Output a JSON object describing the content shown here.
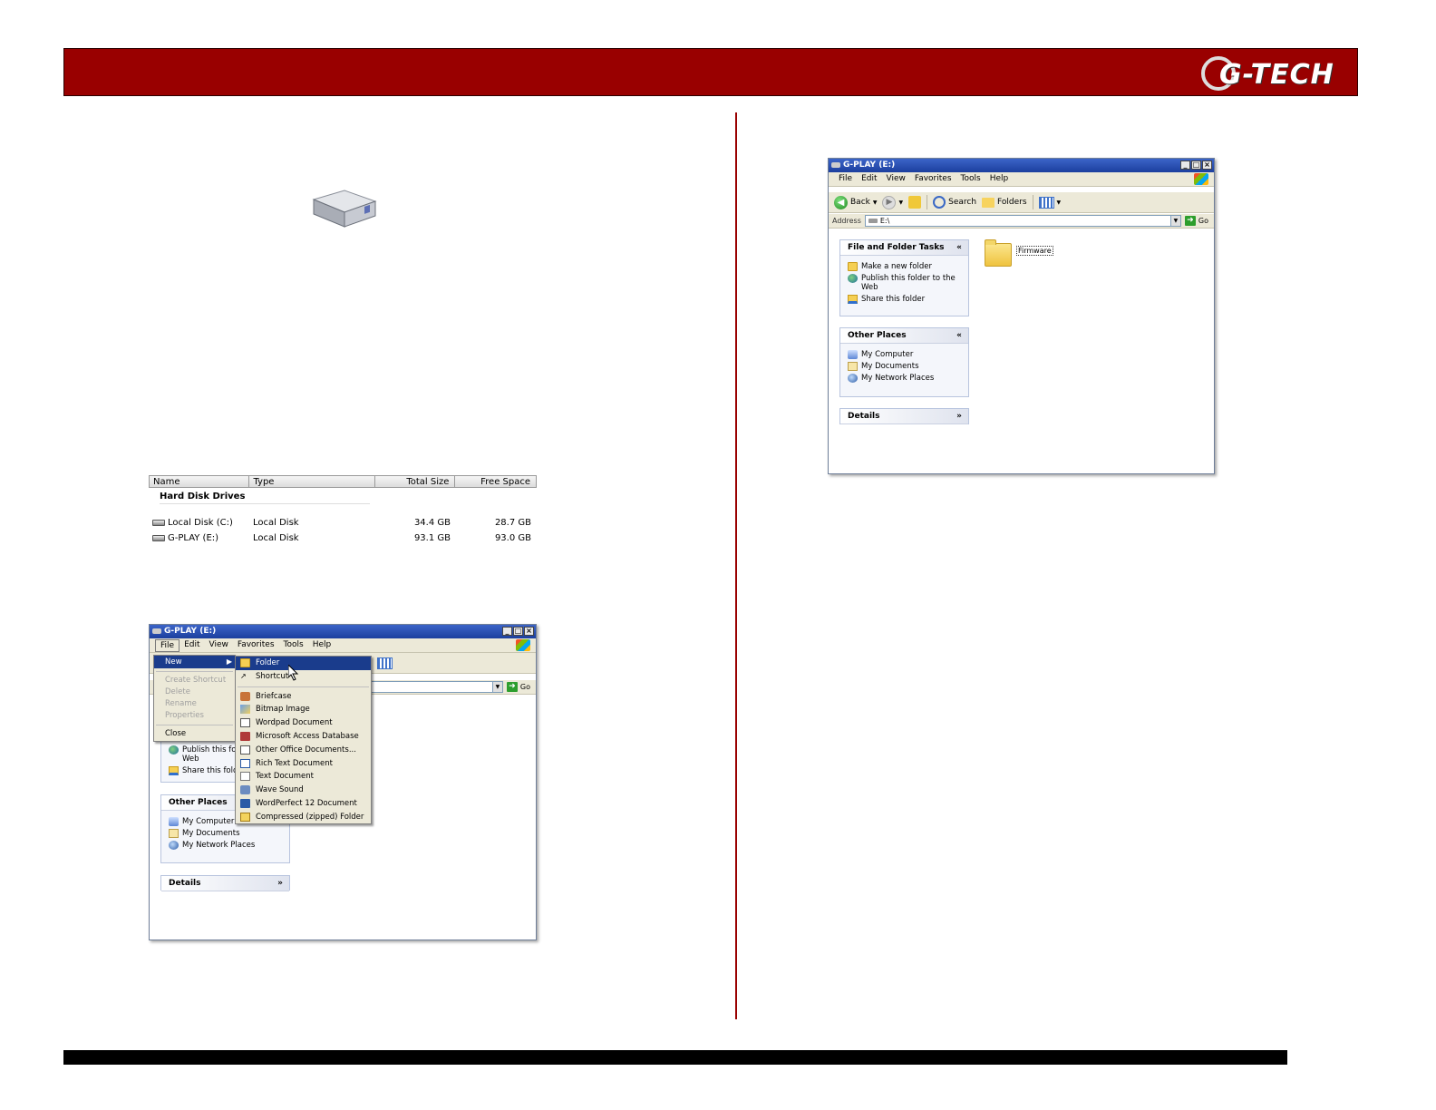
{
  "header": {
    "logo_text": "G-TECH",
    "color": "#990000"
  },
  "left_window": {
    "title": "G-PLAY (E:)",
    "menu": [
      "File",
      "Edit",
      "View",
      "Favorites",
      "Tools",
      "Help"
    ],
    "go_label": "Go",
    "file_menu": [
      {
        "label": "New",
        "state": "selected",
        "submenu": true
      },
      {
        "label": "Create Shortcut",
        "state": "disabled"
      },
      {
        "label": "Delete",
        "state": "disabled"
      },
      {
        "label": "Rename",
        "state": "disabled"
      },
      {
        "label": "Properties",
        "state": "disabled"
      },
      {
        "label": "Close",
        "state": "normal"
      }
    ],
    "new_submenu": [
      {
        "label": "Folder",
        "icon": "folder-icon"
      },
      {
        "label": "Shortcut",
        "icon": "shortcut-icon"
      },
      {
        "label": "Briefcase",
        "icon": "briefcase-icon"
      },
      {
        "label": "Bitmap Image",
        "icon": "bitmap-icon"
      },
      {
        "label": "Wordpad Document",
        "icon": "wordpad-icon"
      },
      {
        "label": "Microsoft Access Database",
        "icon": "access-icon"
      },
      {
        "label": "Other Office Documents...",
        "icon": "office-icon"
      },
      {
        "label": "Rich Text Document",
        "icon": "rtf-icon"
      },
      {
        "label": "Text Document",
        "icon": "text-icon"
      },
      {
        "label": "Wave Sound",
        "icon": "wave-icon"
      },
      {
        "label": "WordPerfect 12 Document",
        "icon": "wordperfect-icon"
      },
      {
        "label": "Compressed (zipped) Folder",
        "icon": "zip-icon"
      }
    ],
    "tasks_partial": [
      "Publish this fol",
      "Web",
      "Share this fold"
    ],
    "other_places": {
      "title": "Other Places",
      "items": [
        "My Computer",
        "My Documents",
        "My Network Places"
      ]
    },
    "details_title": "Details"
  },
  "disk_list": {
    "columns": [
      "Name",
      "Type",
      "Total Size",
      "Free Space"
    ],
    "group": "Hard Disk Drives",
    "rows": [
      {
        "name": "Local Disk (C:)",
        "type": "Local Disk",
        "total": "34.4 GB",
        "free": "28.7 GB"
      },
      {
        "name": "G-PLAY (E:)",
        "type": "Local Disk",
        "total": "93.1 GB",
        "free": "93.0 GB"
      }
    ]
  },
  "right_window": {
    "title": "G-PLAY (E:)",
    "menu": [
      "File",
      "Edit",
      "View",
      "Favorites",
      "Tools",
      "Help"
    ],
    "toolbar": {
      "back": "Back",
      "search": "Search",
      "folders": "Folders"
    },
    "address_label": "Address",
    "address_value": "E:\\",
    "go_label": "Go",
    "file_tasks": {
      "title": "File and Folder Tasks",
      "items": [
        "Make a new folder",
        "Publish this folder to the Web",
        "Share this folder"
      ]
    },
    "other_places": {
      "title": "Other Places",
      "items": [
        "My Computer",
        "My Documents",
        "My Network Places"
      ]
    },
    "details_title": "Details",
    "folder_name": "Firmware"
  }
}
